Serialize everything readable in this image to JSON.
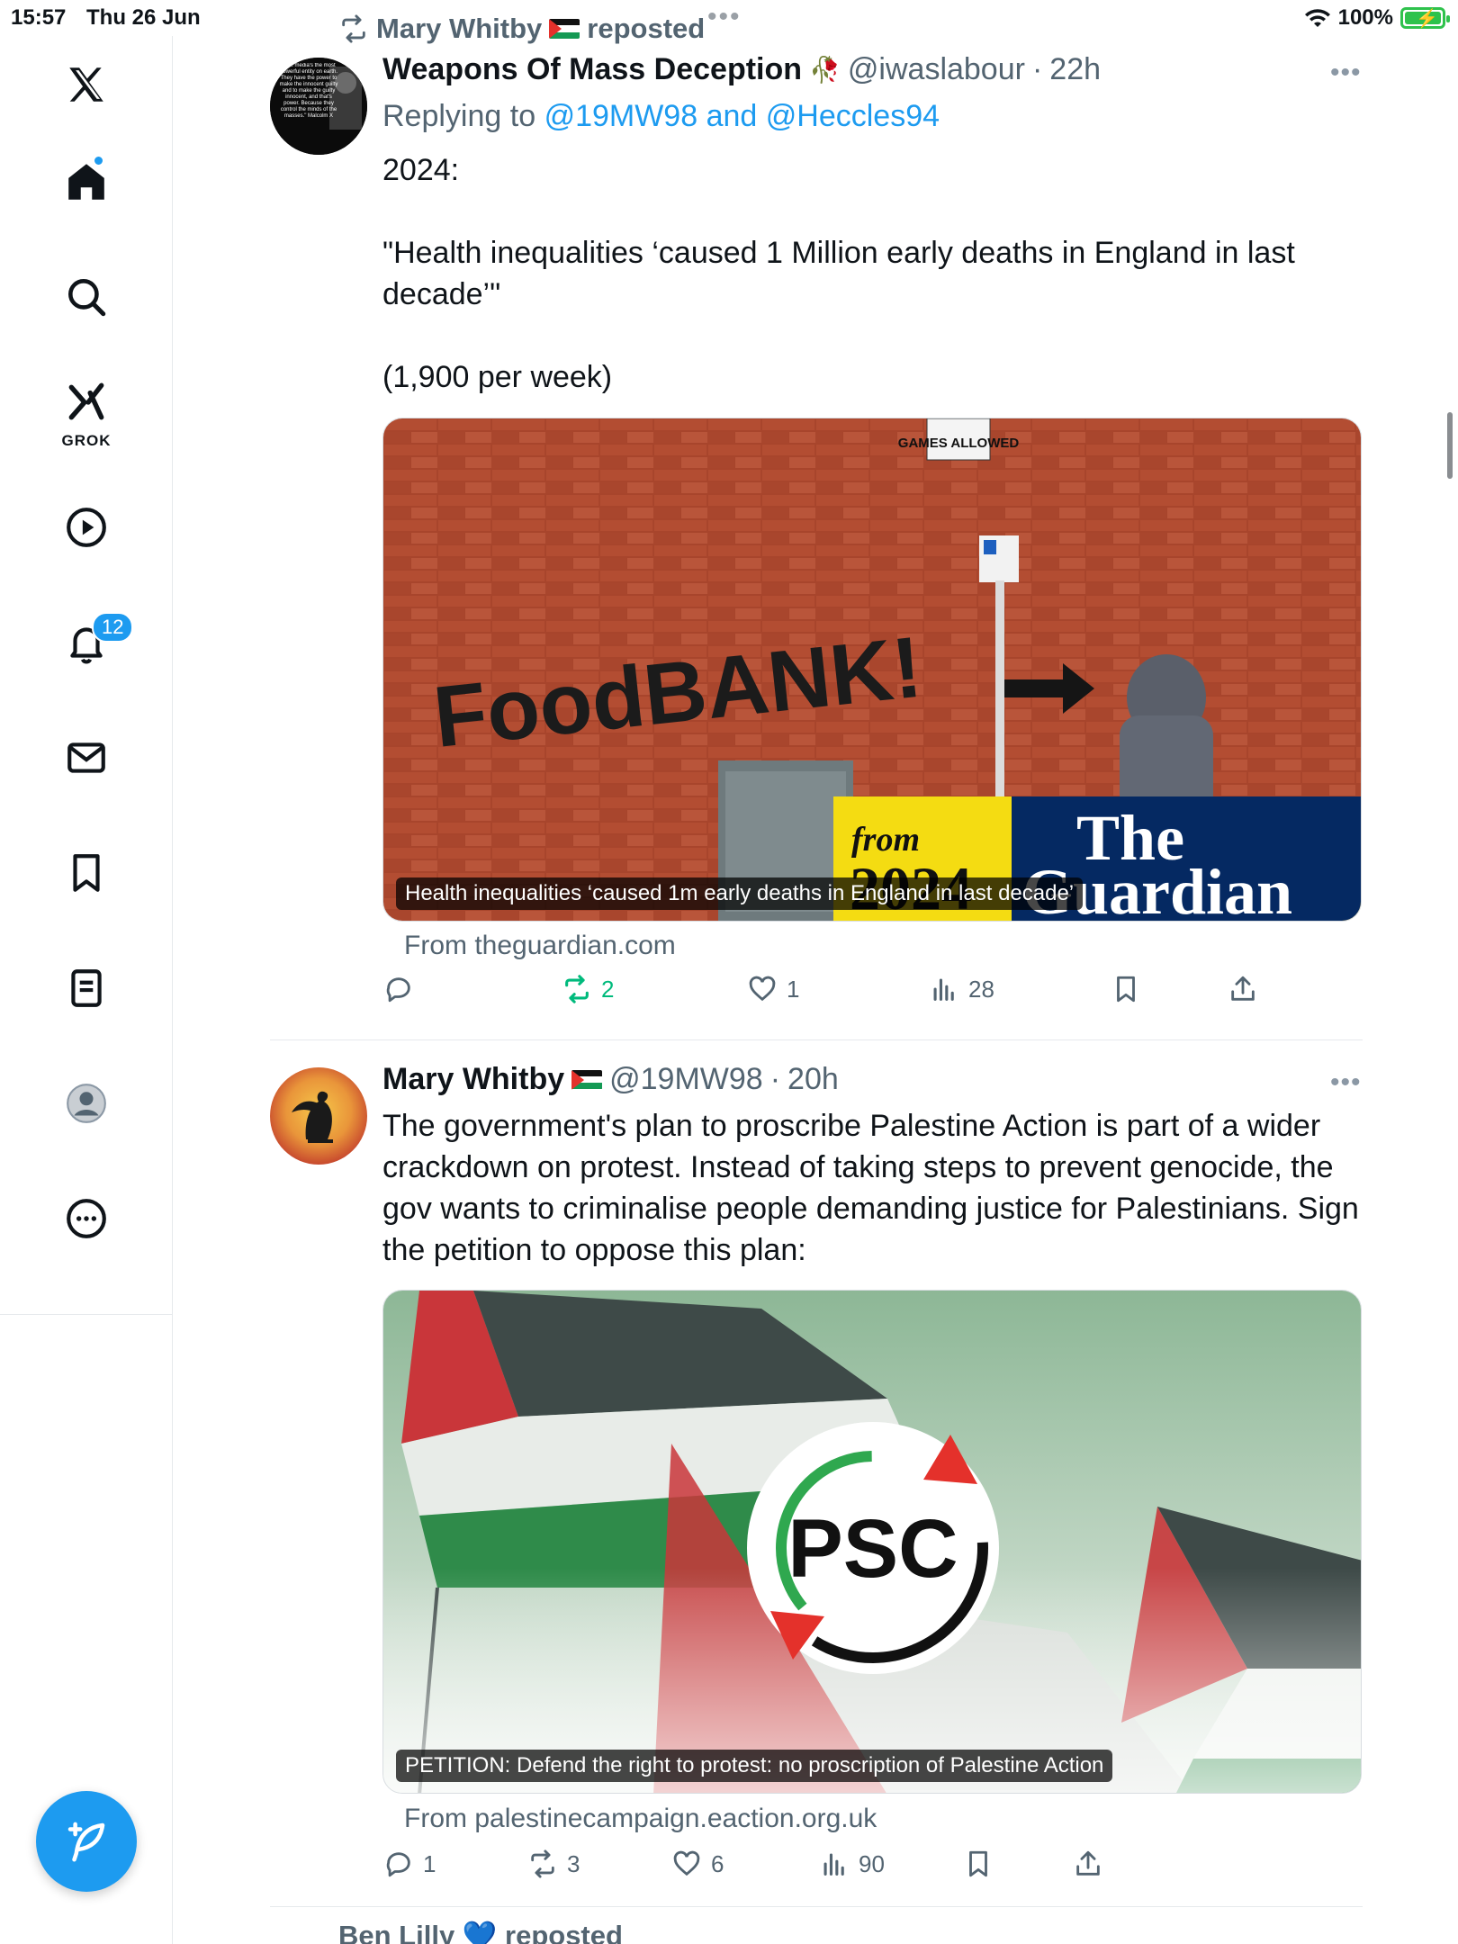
{
  "status_bar": {
    "time": "15:57",
    "date": "Thu 26 Jun",
    "battery": "100%",
    "battery_level": 1.0
  },
  "sidebar": {
    "notifications_badge": "12",
    "grok_label": "GROK"
  },
  "repost": {
    "text": "Mary Whitby",
    "suffix": "reposted"
  },
  "tweet1": {
    "name": "Weapons Of Mass Deception",
    "handle": "@iwaslabour",
    "time": "22h",
    "replying_prefix": "Replying to",
    "replying_to": "@19MW98 and @Heccles94",
    "text": "2024:\n\n\"Health inequalities ‘caused 1 Million early deaths in England in last decade’\"\n\n(1,900 per week)",
    "avatar_text": "\"The media's the most powerful entity on earth. They have the power to make the innocent guilty and to make the guilty innocent, and that's power. Because they control the minds of the masses.\" Malcolm X",
    "card": {
      "sign_text": "GAMES ALLOWED",
      "graffiti": "FoodBANK!",
      "badge_from": "from",
      "badge_year": "2024",
      "brand_line1": "The",
      "brand_line2": "Guardian",
      "caption": "Health inequalities ‘caused 1m early deaths in England in last decade’",
      "source": "From theguardian.com"
    },
    "actions": {
      "replies": "",
      "reposts": "2",
      "likes": "1",
      "views": "28"
    }
  },
  "tweet2": {
    "name": "Mary Whitby",
    "handle": "@19MW98",
    "time": "20h",
    "text": "The government's plan to proscribe Palestine Action is part of a wider crackdown on protest. Instead of taking steps to prevent genocide, the gov wants to criminalise people demanding justice for Palestinians. Sign the petition to oppose this plan:",
    "card": {
      "logo_text": "PSC",
      "caption": "PETITION: Defend the right to protest: no proscription of Palestine Action",
      "source": "From palestinecampaign.eaction.org.uk"
    },
    "actions": {
      "replies": "1",
      "reposts": "3",
      "likes": "6",
      "views": "90"
    }
  },
  "next_repost": {
    "text": "Ben Lilly 💙 reposted"
  },
  "colors": {
    "accent": "#1d9bf0",
    "repost_green": "#00ba7c",
    "muted": "#536471"
  }
}
